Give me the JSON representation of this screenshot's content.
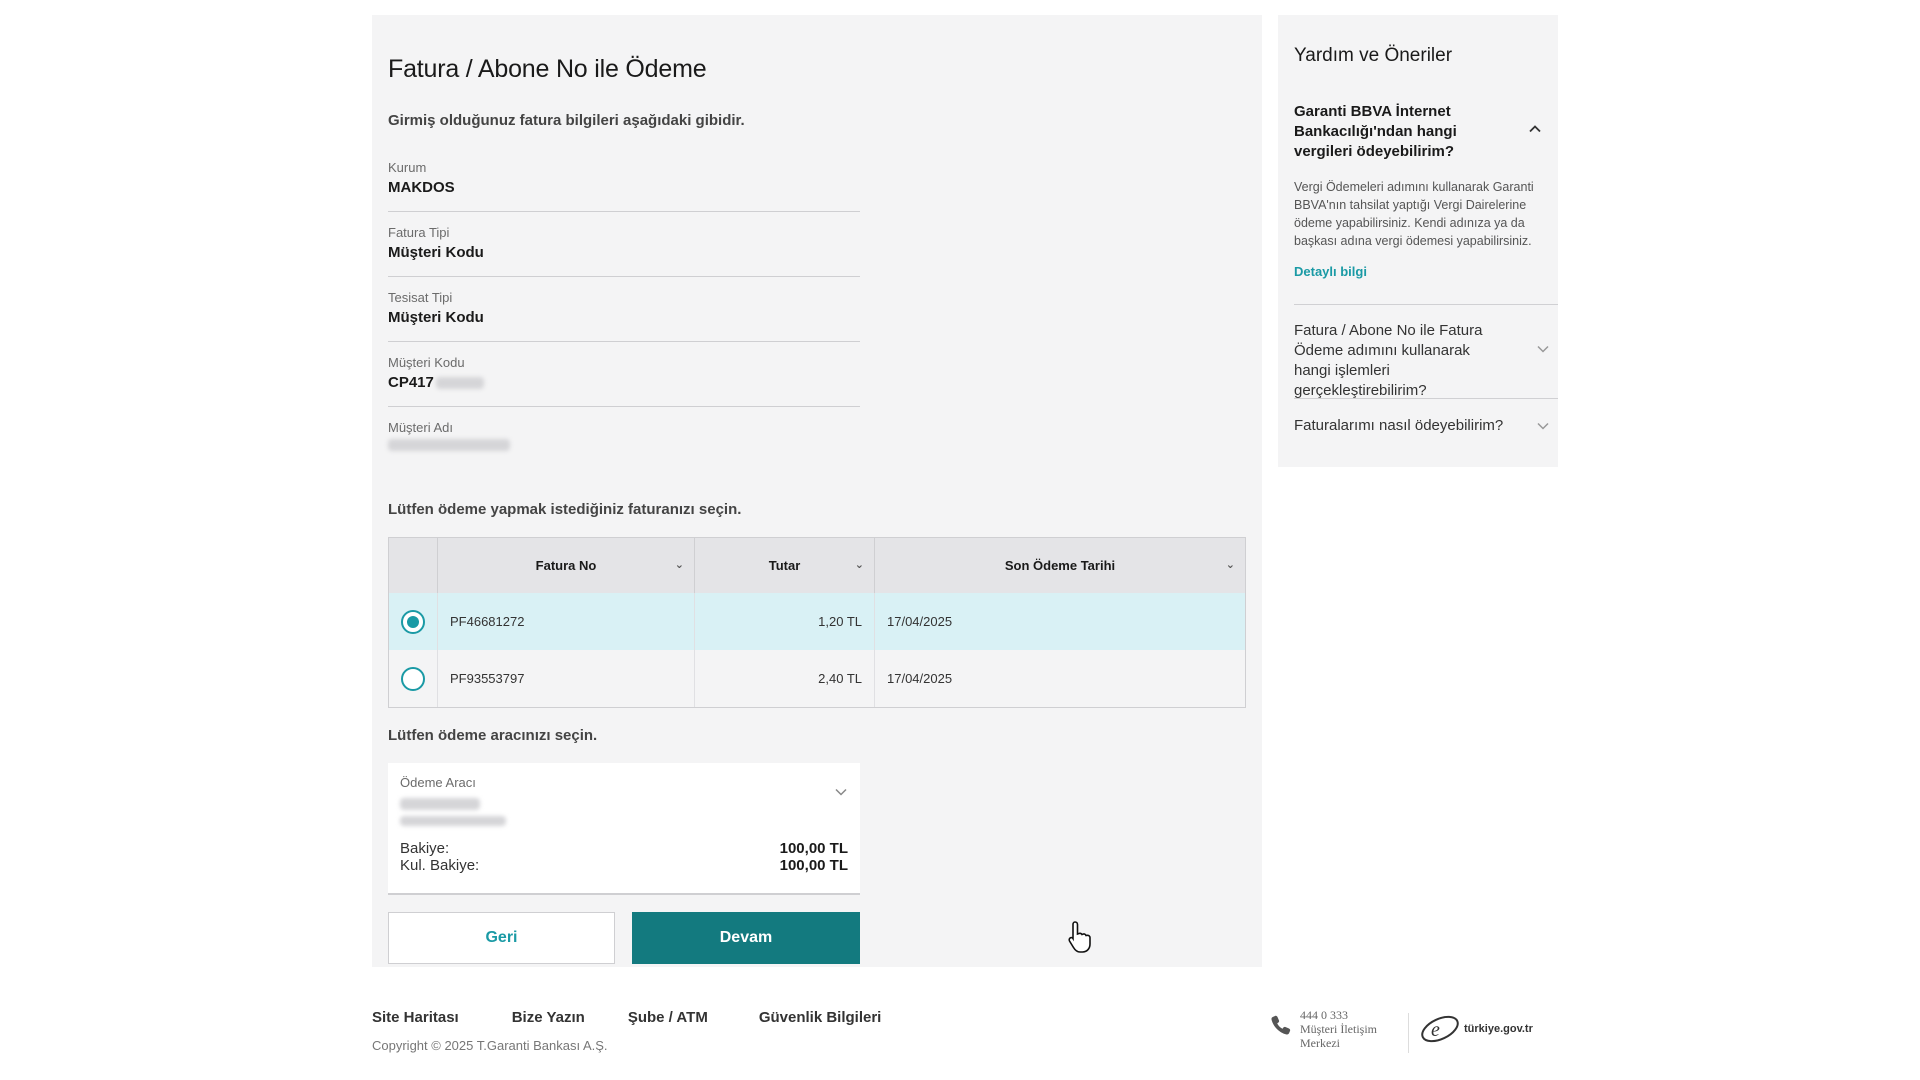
{
  "main": {
    "title": "Fatura / Abone No ile Ödeme",
    "intro": "Girmiş olduğunuz fatura bilgileri aşağıdaki gibidir.",
    "fields": [
      {
        "label": "Kurum",
        "value": "MAKDOS"
      },
      {
        "label": "Fatura Tipi",
        "value": "Müşteri Kodu"
      },
      {
        "label": "Tesisat Tipi",
        "value": "Müşteri Kodu"
      },
      {
        "label": "Müşteri Kodu",
        "value": "CP417"
      },
      {
        "label": "Müşteri Adı",
        "value": ""
      }
    ],
    "select_prompt": "Lütfen ödeme yapmak istediğiniz faturanızı seçin.",
    "table": {
      "headers": [
        "Fatura No",
        "Tutar",
        "Son Ödeme Tarihi"
      ],
      "rows": [
        {
          "invoice_no": "PF46681272",
          "amount": "1,20 TL",
          "due_date": "17/04/2025",
          "selected": true
        },
        {
          "invoice_no": "PF93553797",
          "amount": "2,40 TL",
          "due_date": "17/04/2025",
          "selected": false
        }
      ]
    },
    "payment_prompt": "Lütfen ödeme aracınızı seçin.",
    "payment_tool": {
      "label": "Ödeme Aracı",
      "balance_label": "Bakiye:",
      "balance_value": "100,00 TL",
      "usable_balance_label": "Kul. Bakiye:",
      "usable_balance_value": "100,00 TL"
    },
    "buttons": {
      "back": "Geri",
      "continue": "Devam"
    }
  },
  "sidebar": {
    "title": "Yardım ve Öneriler",
    "faq_open": {
      "question": "Garanti BBVA İnternet Bankacılığı'ndan hangi vergileri ödeyebilirim?",
      "answer": "Vergi Ödemeleri adımını kullanarak Garanti BBVA'nın tahsilat yaptığı Vergi Dairelerine ödeme yapabilirsiniz. Kendi adınıza ya da başkası adına vergi ödemesi yapabilirsiniz.",
      "link": "Detaylı bilgi"
    },
    "faq_items": [
      "Fatura / Abone No ile Fatura Ödeme adımını kullanarak hangi işlemleri gerçekleştirebilirim?",
      "Faturalarımı nasıl ödeyebilirim?"
    ]
  },
  "footer": {
    "links": [
      "Site Haritası",
      "Bize Yazın",
      "Şube / ATM",
      "Güvenlik Bilgileri"
    ],
    "copyright": "Copyright © 2025 T.Garanti Bankası A.Ş.",
    "phone": "444 0 333",
    "call_center_line1": "Müşteri İletişim",
    "call_center_line2": "Merkezi",
    "egov": "türkiye.gov.tr"
  },
  "colors": {
    "accent": "#1a9aa5",
    "primary_button": "#137a7f",
    "selected_row": "#d9f1f5",
    "card_bg": "#f4f4f5"
  }
}
